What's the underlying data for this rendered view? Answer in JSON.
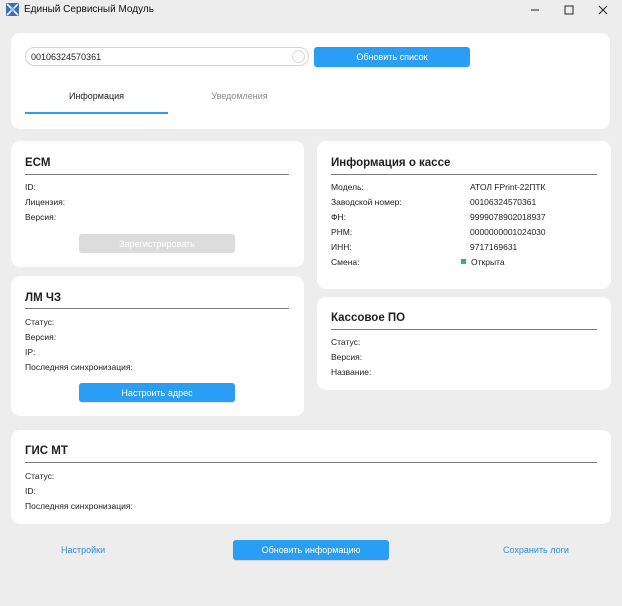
{
  "window": {
    "title": "Единый Сервисный Модуль",
    "min_glyph": "—",
    "max_glyph": "☐",
    "close_glyph": "✕"
  },
  "colors": {
    "accent": "#2a9df4",
    "status_open": "#4caf50",
    "link": "#2a8fdc"
  },
  "header": {
    "device_select_value": "00106324570361",
    "refresh_list_label": "Обновить список",
    "tabs": [
      {
        "label": "Информация",
        "active": true
      },
      {
        "label": "Уведомления",
        "active": false
      }
    ]
  },
  "ecm": {
    "title": "ЕСМ",
    "rows": [
      {
        "label": "ID:",
        "value": ""
      },
      {
        "label": "Лицензия:",
        "value": ""
      },
      {
        "label": "Версия:",
        "value": ""
      }
    ],
    "register_label": "Зарегистрировать"
  },
  "lm": {
    "title": "ЛМ ЧЗ",
    "rows": [
      {
        "label": "Статус:",
        "value": ""
      },
      {
        "label": "Версия:",
        "value": ""
      },
      {
        "label": "IP:",
        "value": ""
      },
      {
        "label": "Последняя синхронизация:",
        "value": ""
      }
    ],
    "configure_label": "Настроить адрес"
  },
  "kassa": {
    "title": "Информация о кассе",
    "rows": [
      {
        "label": "Модель:",
        "value": "АТОЛ FPrint-22ПТК"
      },
      {
        "label": "Заводской номер:",
        "value": "00106324570361"
      },
      {
        "label": "ФН:",
        "value": "9999078902018937"
      },
      {
        "label": "РНМ:",
        "value": "0000000001024030"
      },
      {
        "label": "ИНН:",
        "value": "9717169631"
      },
      {
        "label": "Смена:",
        "value": "Открыта"
      }
    ]
  },
  "po": {
    "title": "Кассовое ПО",
    "rows": [
      {
        "label": "Статус:",
        "value": ""
      },
      {
        "label": "Версия:",
        "value": ""
      },
      {
        "label": "Название:",
        "value": ""
      }
    ]
  },
  "gis": {
    "title": "ГИС МТ",
    "rows": [
      {
        "label": "Статус:",
        "value": ""
      },
      {
        "label": "ID:",
        "value": ""
      },
      {
        "label": "Последняя синхронизация:",
        "value": ""
      }
    ]
  },
  "footer": {
    "settings_label": "Настройки",
    "update_info_label": "Обновить информацию",
    "save_logs_label": "Сохранить логи"
  }
}
